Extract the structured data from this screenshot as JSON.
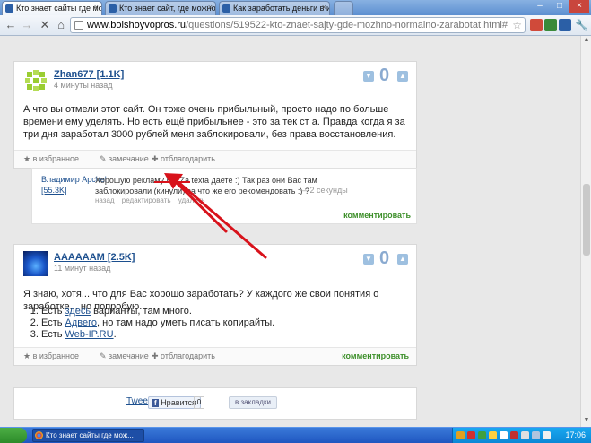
{
  "browser": {
    "tabs": [
      {
        "title": "Кто знает сайты где можно"
      },
      {
        "title": "Кто знает сайт, где можно"
      },
      {
        "title": "Как заработать деньги в и"
      }
    ],
    "url_host": "www.bolshoyvopros.ru",
    "url_path": "/questions/519522-kto-znaet-sajty-gde-mozhno-normalno-zarabotat.html#"
  },
  "answers": [
    {
      "author": "Zhan677 [1.1K]",
      "time": "4 минуты назад",
      "score": "0",
      "text": "А что вы отмели этот сайт. Он тоже очень прибыльный, просто надо по больше времени ему уделять. Но есть ещё прибыльнее - это за тек ст а. Правда когда я за три дня заработал 3000 рублей меня заблокировали, без права восстановления.",
      "actions": {
        "fav": "в избранное",
        "remark": "замечание",
        "thank": "отблагодарить"
      }
    },
    {
      "author": "AAAAAAM [2.5K]",
      "time": "11 минут назад",
      "score": "0",
      "text": "Я знаю, хотя... что для Вас хорошо заработать? У каждого же свои понятия о заработке... но попробую...",
      "list": [
        {
          "prefix": "Есть ",
          "link": "здесь",
          "suffix": " варианты, там много."
        },
        {
          "prefix": "Есть ",
          "link": "Адвего",
          "suffix": ", но там надо уметь писать копирайты."
        },
        {
          "prefix": "Есть ",
          "link": "Web-IP.RU",
          "suffix": "."
        }
      ],
      "actions": {
        "fav": "в избранное",
        "remark": "замечание",
        "thank": "отблагодарить",
        "comment": "комментировать"
      }
    }
  ],
  "comment": {
    "author": "Владимир Apchel",
    "rep": "[55.3K]",
    "text": "Хорошую рекламу Вы Za texta даете :) Так раз они Вас там заблокировали (кинули) за что же его рекомендовать :) ?",
    "time": "— 2 секунды",
    "actions": {
      "back": "назад",
      "edit": "редактировать",
      "delete": "удалить"
    },
    "add": "комментировать"
  },
  "share": {
    "tweet": "Tweet",
    "fb_label": "Нравится",
    "fb_count": "0",
    "bookmark": "в закладки"
  },
  "taskbar": {
    "item": "Кто знает сайты где мож...",
    "clock": "17:06"
  },
  "colors": {
    "accent_red": "#d8121b",
    "link_blue": "#1c4f8e",
    "comment_green": "#3d8f2a"
  }
}
